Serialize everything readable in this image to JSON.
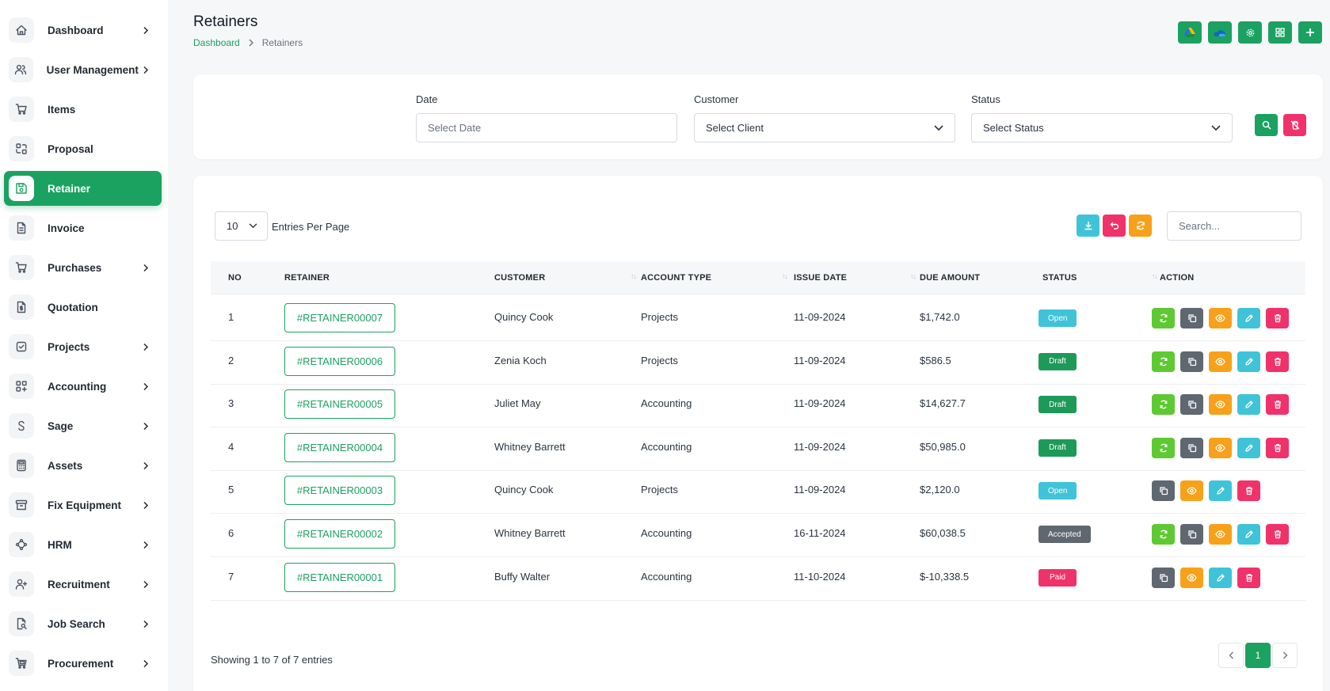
{
  "sidebar": {
    "items": [
      {
        "label": "Dashboard",
        "icon": "home-icon",
        "chevron": true
      },
      {
        "label": "User Management",
        "icon": "users-icon",
        "chevron": true
      },
      {
        "label": "Items",
        "icon": "cart-icon",
        "chevron": false
      },
      {
        "label": "Proposal",
        "icon": "proposal-icon",
        "chevron": false
      },
      {
        "label": "Retainer",
        "icon": "save-icon",
        "chevron": false,
        "active": true
      },
      {
        "label": "Invoice",
        "icon": "file-icon",
        "chevron": false
      },
      {
        "label": "Purchases",
        "icon": "cart-icon",
        "chevron": true
      },
      {
        "label": "Quotation",
        "icon": "file-dollar-icon",
        "chevron": false
      },
      {
        "label": "Projects",
        "icon": "checkbox-icon",
        "chevron": true
      },
      {
        "label": "Accounting",
        "icon": "grid-plus-icon",
        "chevron": true
      },
      {
        "label": "Sage",
        "icon": "s-letter-icon",
        "chevron": true
      },
      {
        "label": "Assets",
        "icon": "calculator-icon",
        "chevron": true
      },
      {
        "label": "Fix Equipment",
        "icon": "archive-icon",
        "chevron": true
      },
      {
        "label": "HRM",
        "icon": "network-icon",
        "chevron": true
      },
      {
        "label": "Recruitment",
        "icon": "user-plus-icon",
        "chevron": true
      },
      {
        "label": "Job Search",
        "icon": "file-search-icon",
        "chevron": true
      },
      {
        "label": "Procurement",
        "icon": "cart-box-icon",
        "chevron": true
      }
    ]
  },
  "header": {
    "title": "Retainers",
    "breadcrumb": {
      "home": "Dashboard",
      "current": "Retainers"
    },
    "actions": [
      {
        "name": "google-drive-button",
        "icon": "google-drive-icon"
      },
      {
        "name": "onedrive-button",
        "icon": "cloud-icon"
      },
      {
        "name": "settings-button",
        "icon": "gear-icon"
      },
      {
        "name": "grid-view-button",
        "icon": "grid-icon"
      },
      {
        "name": "add-retainer-button",
        "icon": "plus-icon"
      }
    ]
  },
  "filters": {
    "date": {
      "label": "Date",
      "placeholder": "Select Date"
    },
    "customer": {
      "label": "Customer",
      "value": "Select Client"
    },
    "status": {
      "label": "Status",
      "value": "Select Status"
    }
  },
  "table_controls": {
    "per_page": "10",
    "per_page_label": "Entries Per Page",
    "search_placeholder": "Search..."
  },
  "table": {
    "columns": [
      "NO",
      "RETAINER",
      "CUSTOMER",
      "ACCOUNT TYPE",
      "ISSUE DATE",
      "DUE AMOUNT",
      "STATUS",
      "ACTION"
    ],
    "rows": [
      {
        "no": "1",
        "retainer": "#RETAINER00007",
        "customer": "Quincy Cook",
        "account_type": "Projects",
        "issue_date": "11-09-2024",
        "due_amount": "$1,742.0",
        "status": "Open",
        "convert": true
      },
      {
        "no": "2",
        "retainer": "#RETAINER00006",
        "customer": "Zenia Koch",
        "account_type": "Projects",
        "issue_date": "11-09-2024",
        "due_amount": "$586.5",
        "status": "Draft",
        "convert": true
      },
      {
        "no": "3",
        "retainer": "#RETAINER00005",
        "customer": "Juliet May",
        "account_type": "Accounting",
        "issue_date": "11-09-2024",
        "due_amount": "$14,627.7",
        "status": "Draft",
        "convert": true
      },
      {
        "no": "4",
        "retainer": "#RETAINER00004",
        "customer": "Whitney Barrett",
        "account_type": "Accounting",
        "issue_date": "11-09-2024",
        "due_amount": "$50,985.0",
        "status": "Draft",
        "convert": true
      },
      {
        "no": "5",
        "retainer": "#RETAINER00003",
        "customer": "Quincy Cook",
        "account_type": "Projects",
        "issue_date": "11-09-2024",
        "due_amount": "$2,120.0",
        "status": "Open",
        "convert": false
      },
      {
        "no": "6",
        "retainer": "#RETAINER00002",
        "customer": "Whitney Barrett",
        "account_type": "Accounting",
        "issue_date": "16-11-2024",
        "due_amount": "$60,038.5",
        "status": "Accepted",
        "convert": true
      },
      {
        "no": "7",
        "retainer": "#RETAINER00001",
        "customer": "Buffy Walter",
        "account_type": "Accounting",
        "issue_date": "11-10-2024",
        "due_amount": "$-10,338.5",
        "status": "Paid",
        "convert": false
      }
    ]
  },
  "footer": {
    "showing": "Showing 1 to 7 of 7 entries",
    "current_page": "1"
  },
  "colors": {
    "accent": "#1ba160",
    "open": "#3fc3d8",
    "draft": "#1e9a58",
    "accepted": "#5f6770",
    "paid": "#f0326a",
    "convert": "#5ec932",
    "copy": "#5f6770",
    "view": "#f7a11a",
    "edit": "#3fc3d8",
    "delete": "#f0326a"
  }
}
